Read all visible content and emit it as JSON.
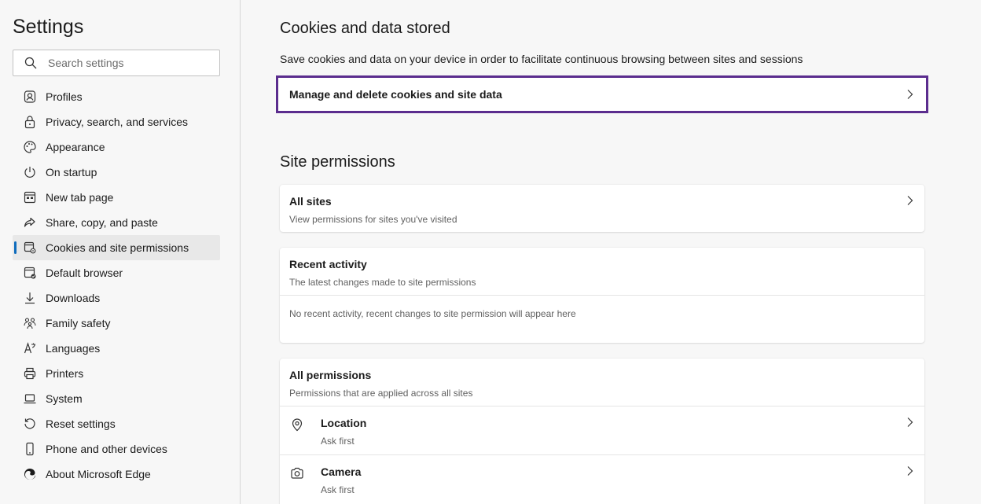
{
  "sidebar": {
    "title": "Settings",
    "search": {
      "placeholder": "Search settings",
      "icon": "search-icon"
    },
    "items": [
      {
        "label": "Profiles",
        "icon": "profile-icon",
        "active": false
      },
      {
        "label": "Privacy, search, and services",
        "icon": "lock-icon",
        "active": false
      },
      {
        "label": "Appearance",
        "icon": "palette-icon",
        "active": false
      },
      {
        "label": "On startup",
        "icon": "power-icon",
        "active": false
      },
      {
        "label": "New tab page",
        "icon": "grid-icon",
        "active": false
      },
      {
        "label": "Share, copy, and paste",
        "icon": "share-icon",
        "active": false
      },
      {
        "label": "Cookies and site permissions",
        "icon": "cookie-icon",
        "active": true
      },
      {
        "label": "Default browser",
        "icon": "browser-icon",
        "active": false
      },
      {
        "label": "Downloads",
        "icon": "download-icon",
        "active": false
      },
      {
        "label": "Family safety",
        "icon": "family-icon",
        "active": false
      },
      {
        "label": "Languages",
        "icon": "language-icon",
        "active": false
      },
      {
        "label": "Printers",
        "icon": "printer-icon",
        "active": false
      },
      {
        "label": "System",
        "icon": "laptop-icon",
        "active": false
      },
      {
        "label": "Reset settings",
        "icon": "reset-icon",
        "active": false
      },
      {
        "label": "Phone and other devices",
        "icon": "phone-icon",
        "active": false
      },
      {
        "label": "About Microsoft Edge",
        "icon": "edge-icon",
        "active": false
      }
    ]
  },
  "cookies": {
    "title": "Cookies and data stored",
    "description": "Save cookies and data on your device in order to facilitate continuous browsing between sites and sessions",
    "manage_label": "Manage and delete cookies and site data"
  },
  "permissions": {
    "title": "Site permissions",
    "all_sites": {
      "title": "All sites",
      "subtitle": "View permissions for sites you've visited"
    },
    "recent": {
      "title": "Recent activity",
      "subtitle": "The latest changes made to site permissions",
      "empty_text": "No recent activity, recent changes to site permission will appear here"
    },
    "all_permissions": {
      "title": "All permissions",
      "subtitle": "Permissions that are applied across all sites",
      "items": [
        {
          "title": "Location",
          "subtitle": "Ask first",
          "icon": "location-icon"
        },
        {
          "title": "Camera",
          "subtitle": "Ask first",
          "icon": "camera-icon"
        }
      ]
    }
  },
  "colors": {
    "accent": "#0f6cbd",
    "focus_border": "#5b2d8e",
    "background": "#f7f7f7"
  }
}
